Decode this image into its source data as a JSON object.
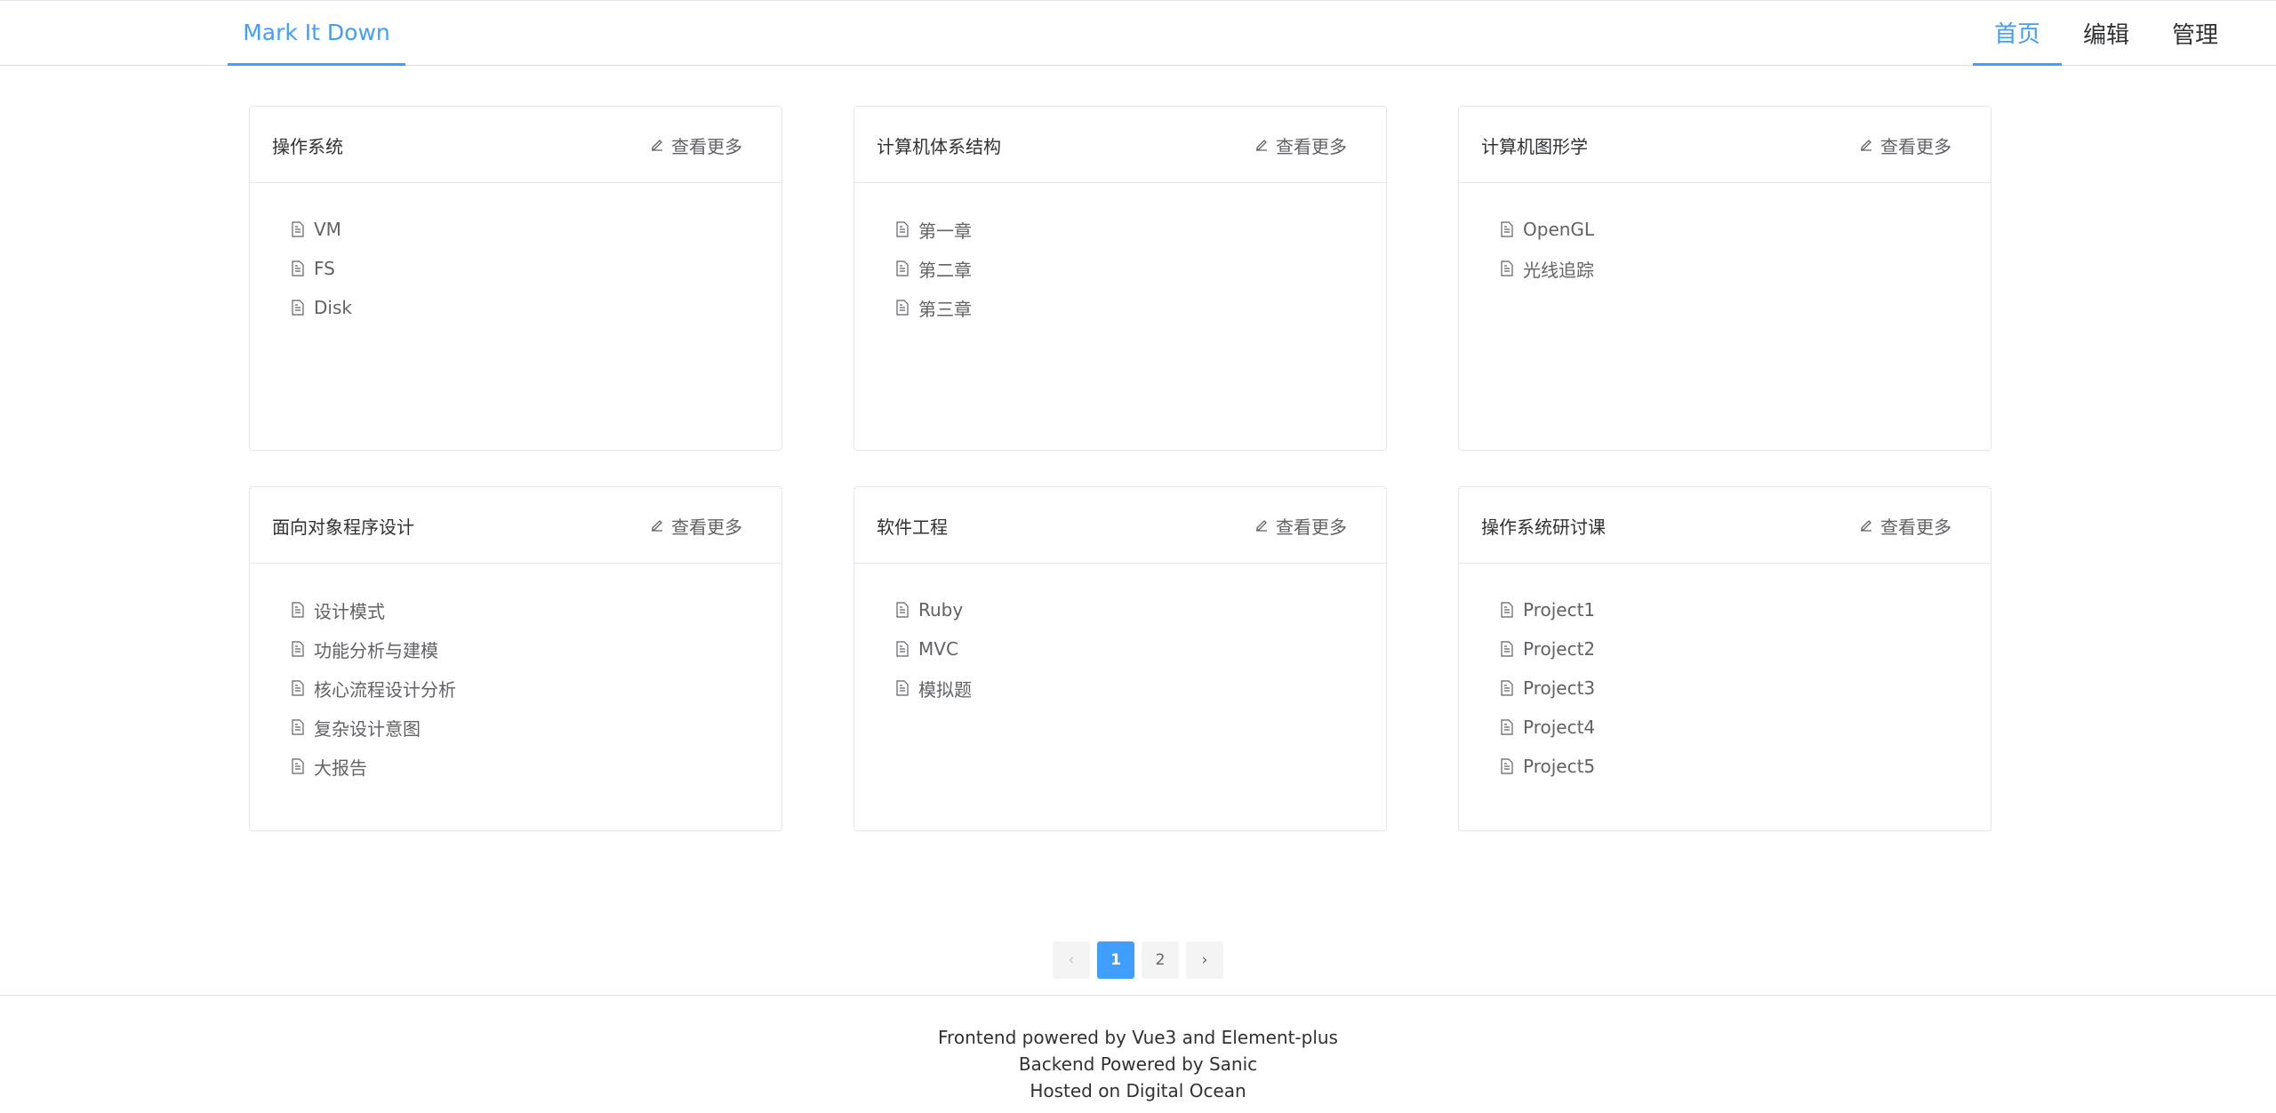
{
  "header": {
    "brand": "Mark It Down",
    "nav": [
      {
        "label": "首页",
        "active": true
      },
      {
        "label": "编辑",
        "active": false
      },
      {
        "label": "管理",
        "active": false
      }
    ]
  },
  "more_label": "查看更多",
  "cards": [
    {
      "title": "操作系统",
      "items": [
        "VM",
        "FS",
        "Disk"
      ]
    },
    {
      "title": "计算机体系结构",
      "items": [
        "第一章",
        "第二章",
        "第三章"
      ]
    },
    {
      "title": "计算机图形学",
      "items": [
        "OpenGL",
        "光线追踪"
      ]
    },
    {
      "title": "面向对象程序设计",
      "items": [
        "设计模式",
        "功能分析与建模",
        "核心流程设计分析",
        "复杂设计意图",
        "大报告"
      ]
    },
    {
      "title": "软件工程",
      "items": [
        "Ruby",
        "MVC",
        "模拟题"
      ]
    },
    {
      "title": "操作系统研讨课",
      "items": [
        "Project1",
        "Project2",
        "Project3",
        "Project4",
        "Project5"
      ]
    }
  ],
  "pagination": {
    "prev": "‹",
    "next": "›",
    "pages": [
      "1",
      "2"
    ],
    "current": "1"
  },
  "footer": {
    "lines": [
      "Frontend powered by Vue3 and Element-plus",
      "Backend Powered by Sanic",
      "Hosted on Digital Ocean"
    ]
  },
  "colors": {
    "accent": "#409eff",
    "text": "#303133",
    "muted": "#606266",
    "border": "#e4e7ed"
  }
}
